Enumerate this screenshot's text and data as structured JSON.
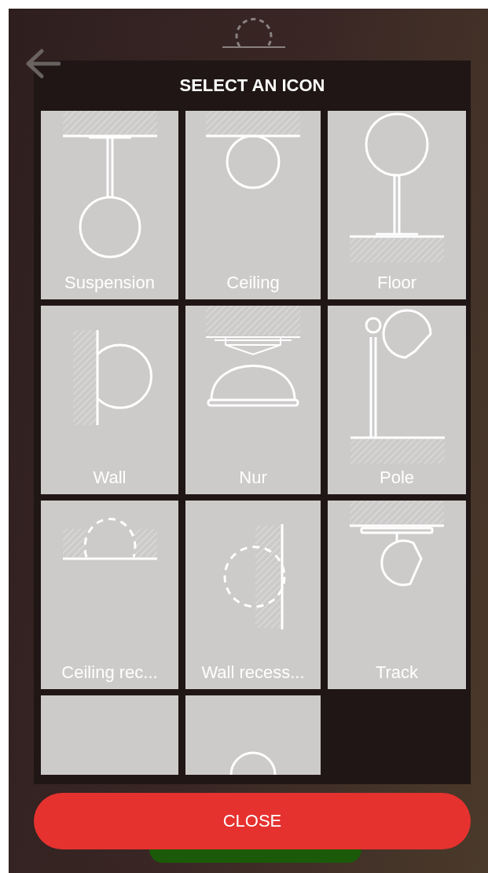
{
  "dialog": {
    "title": "SELECT AN ICON",
    "tiles": [
      {
        "label": "Suspension",
        "kind": "suspension"
      },
      {
        "label": "Ceiling",
        "kind": "ceiling"
      },
      {
        "label": "Floor",
        "kind": "floor"
      },
      {
        "label": "Wall",
        "kind": "wall"
      },
      {
        "label": "Nur",
        "kind": "nur"
      },
      {
        "label": "Pole",
        "kind": "pole"
      },
      {
        "label": "Ceiling rec...",
        "kind": "ceiling-recessed"
      },
      {
        "label": "Wall recess...",
        "kind": "wall-recessed"
      },
      {
        "label": "Track",
        "kind": "track"
      },
      {
        "kind": "blank"
      },
      {
        "kind": "cut-circle"
      }
    ],
    "close_button": "CLOSE"
  }
}
